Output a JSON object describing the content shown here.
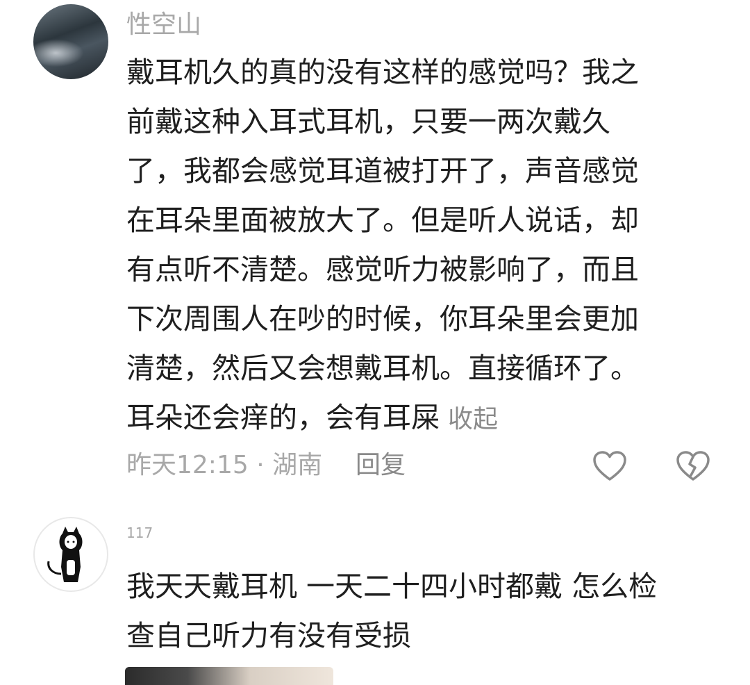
{
  "comments": [
    {
      "username": "性空山",
      "lines": [
        "戴耳机久的真的没有这样的感觉吗？我之",
        "前戴这种入耳式耳机，只要一两次戴久",
        "了，我都会感觉耳道被打开了，声音感觉",
        "在耳朵里面被放大了。但是听人说话，却",
        "有点听不清楚。感觉听力被影响了，而且",
        "下次周围人在吵的时候，你耳朵里会更加",
        "清楚，然后又会想戴耳机。直接循环了。",
        "耳朵还会痒的，会有耳屎"
      ],
      "collapse_label": "收起",
      "meta": "昨天12:15 · 湖南",
      "reply_label": "回复",
      "like_icon": "heart-outline-icon",
      "dislike_icon": "broken-heart-icon"
    },
    {
      "username": "117",
      "lines": [
        "我天天戴耳机 一天二十四小时都戴 怎么检",
        "查自己听力有没有受损"
      ]
    }
  ],
  "colors": {
    "text": "#1f1f1f",
    "muted": "#a8a8a8",
    "icon": "#8a8a8a"
  }
}
